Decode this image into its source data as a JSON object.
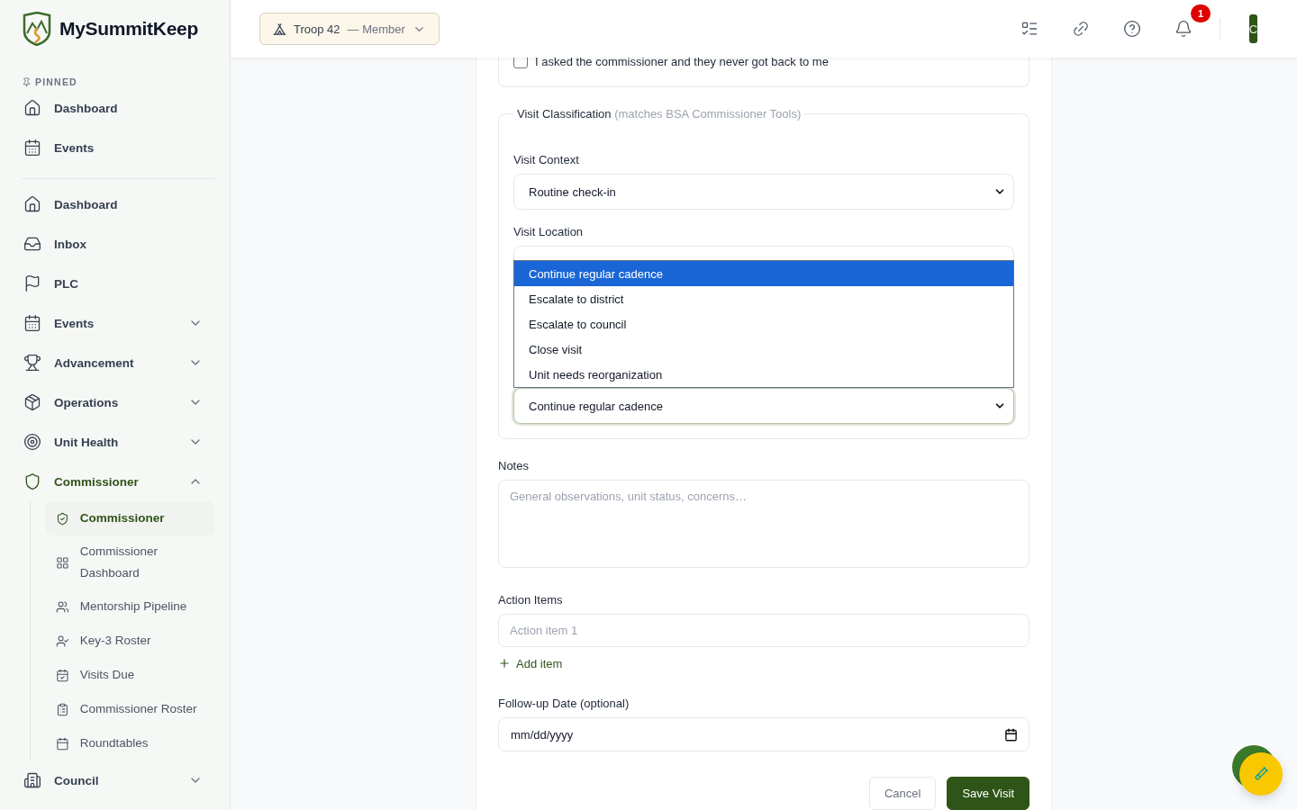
{
  "brand": {
    "name": "MySummitKeep"
  },
  "unit_switcher": {
    "unit": "Troop 42",
    "role": "— Member"
  },
  "header": {
    "notification_count": "1",
    "avatar_initial": "C"
  },
  "sidebar": {
    "pinned_label": "PINNED",
    "pinned": [
      {
        "label": "Dashboard"
      },
      {
        "label": "Events"
      }
    ],
    "nav": [
      {
        "label": "Dashboard",
        "kind": "link",
        "selected": false
      },
      {
        "label": "Inbox",
        "kind": "link",
        "selected": false
      },
      {
        "label": "PLC",
        "kind": "link",
        "selected": false
      },
      {
        "label": "Events",
        "kind": "group",
        "selected": false,
        "expanded": false
      },
      {
        "label": "Advancement",
        "kind": "group",
        "selected": false,
        "expanded": false
      },
      {
        "label": "Operations",
        "kind": "group",
        "selected": false,
        "expanded": false
      },
      {
        "label": "Unit Health",
        "kind": "group",
        "selected": false,
        "expanded": false
      },
      {
        "label": "Commissioner",
        "kind": "group",
        "selected": true,
        "expanded": true,
        "children": [
          {
            "label": "Commissioner",
            "selected": true
          },
          {
            "label": "Commissioner Dashboard",
            "selected": false
          },
          {
            "label": "Mentorship Pipeline",
            "selected": false
          },
          {
            "label": "Key-3 Roster",
            "selected": false
          },
          {
            "label": "Visits Due",
            "selected": false
          },
          {
            "label": "Commissioner Roster",
            "selected": false
          },
          {
            "label": "Roundtables",
            "selected": false
          }
        ]
      },
      {
        "label": "Council",
        "kind": "group",
        "selected": false,
        "expanded": false
      }
    ]
  },
  "form": {
    "checkbox_option": {
      "label": "I asked the commissioner and they never got back to me",
      "checked": false
    },
    "classification": {
      "legend": "Visit Classification",
      "legend_note": "(matches BSA Commissioner Tools)",
      "visit_context": {
        "label": "Visit Context",
        "value": "Routine check-in"
      },
      "visit_location": {
        "label": "Visit Location"
      },
      "open_select": {
        "value": "Continue regular cadence",
        "options": [
          {
            "label": "Continue regular cadence",
            "selected": true
          },
          {
            "label": "Escalate to district",
            "selected": false
          },
          {
            "label": "Escalate to council",
            "selected": false
          },
          {
            "label": "Close visit",
            "selected": false
          },
          {
            "label": "Unit needs reorganization",
            "selected": false
          }
        ]
      }
    },
    "notes": {
      "label": "Notes",
      "placeholder": "General observations, unit status, concerns…"
    },
    "action_items": {
      "label": "Action Items",
      "items": [
        {
          "placeholder": "Action item 1"
        }
      ],
      "add_label": "Add item"
    },
    "follow_up": {
      "label": "Follow-up Date (optional)",
      "value": "mm/dd/yyyy"
    },
    "buttons": [
      {
        "label": "Cancel",
        "kind": "secondary"
      },
      {
        "label": "Save Visit",
        "kind": "primary"
      }
    ]
  }
}
